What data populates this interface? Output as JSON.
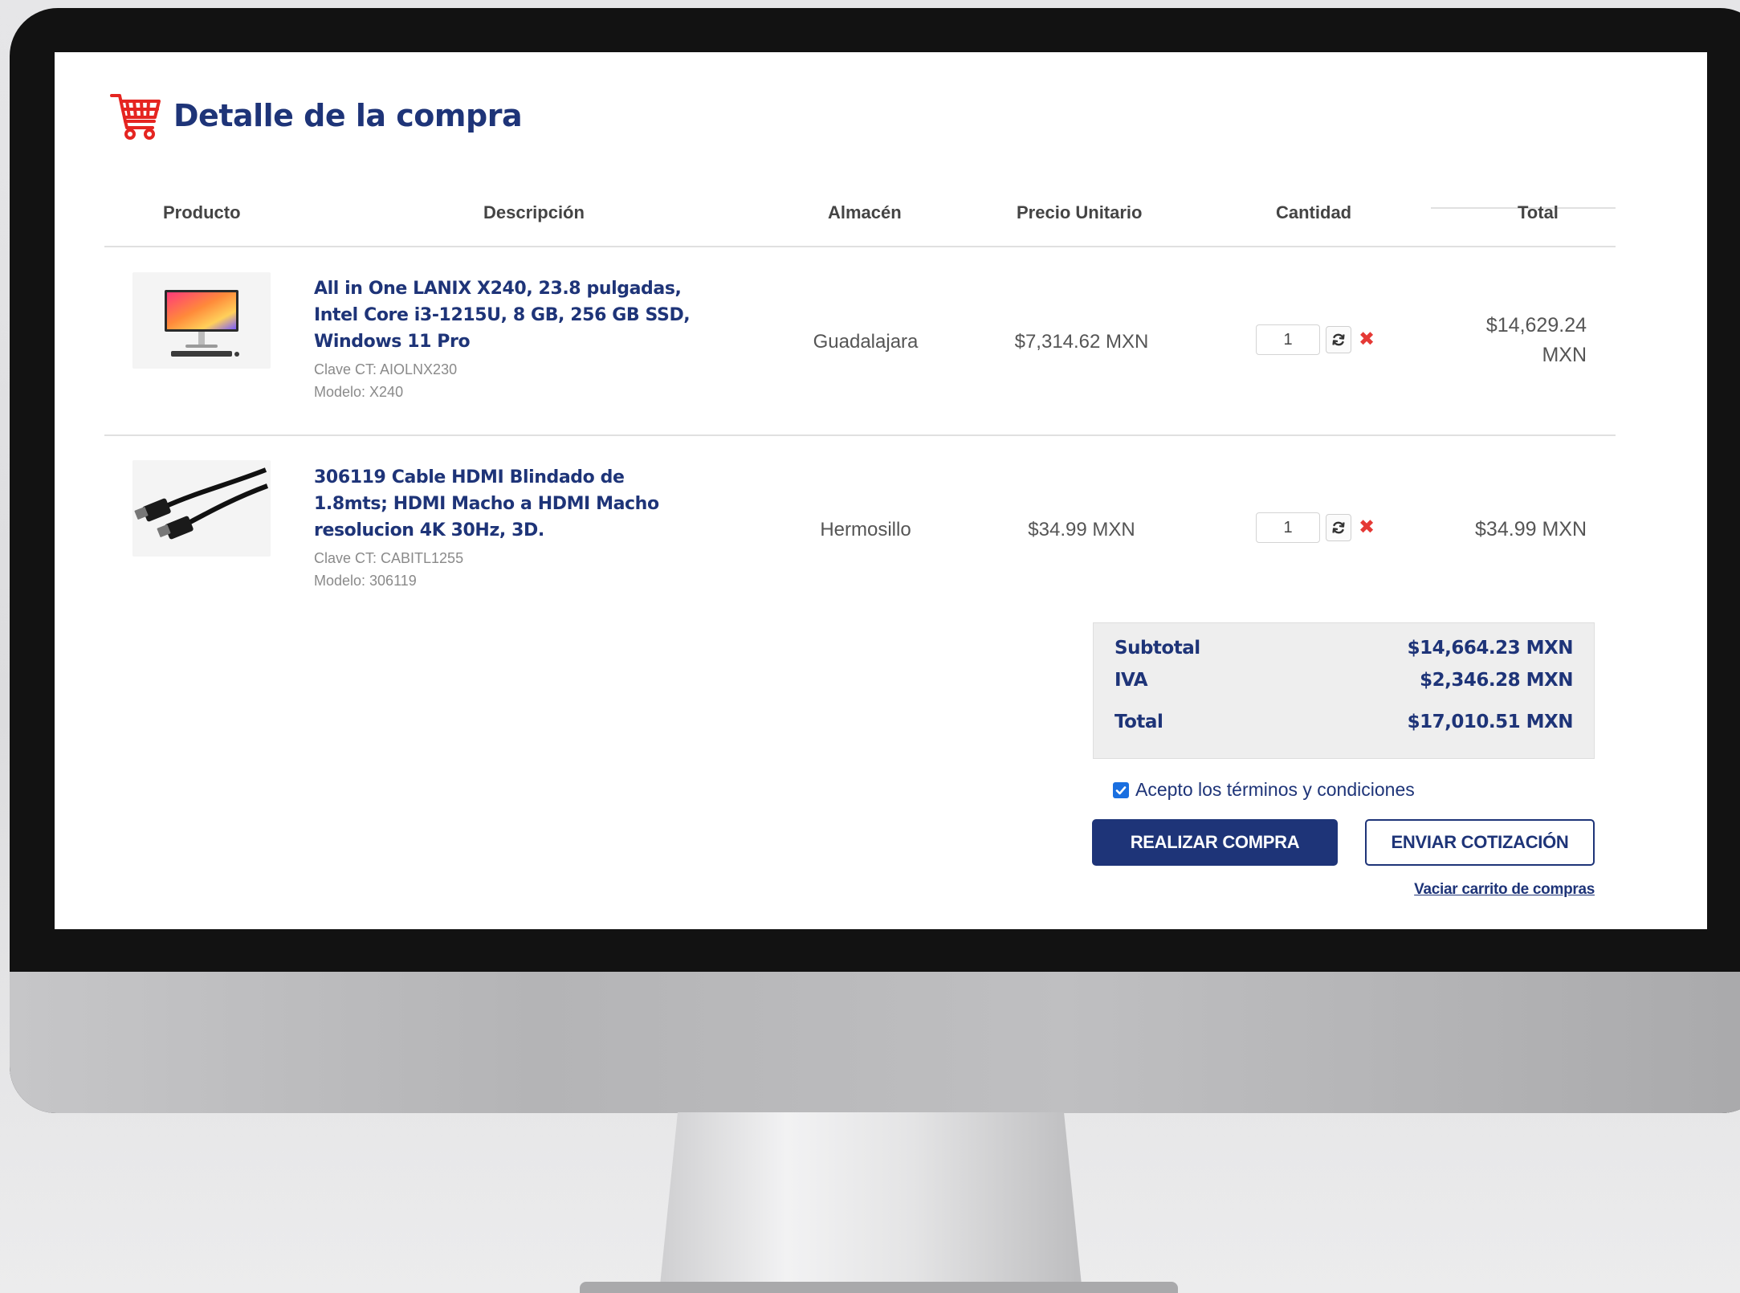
{
  "page": {
    "title": "Detalle de la compra"
  },
  "table": {
    "headers": {
      "product": "Producto",
      "description": "Descripción",
      "warehouse": "Almacén",
      "unit_price": "Precio Unitario",
      "quantity": "Cantidad",
      "total": "Total"
    },
    "rows": [
      {
        "image_icon": "all-in-one-computer-image",
        "title": "All in One LANIX X240, 23.8 pulgadas, Intel Core i3-1215U, 8 GB, 256 GB SSD, Windows 11 Pro",
        "clave": "Clave CT: AIOLNX230",
        "modelo": "Modelo: X240",
        "warehouse": "Guadalajara",
        "unit_price": "$7,314.62 MXN",
        "quantity": "1",
        "total_amount": "$14,629.24",
        "total_currency": "MXN"
      },
      {
        "image_icon": "hdmi-cable-image",
        "title": "306119 Cable HDMI Blindado de 1.8mts; HDMI Macho a HDMI Macho resolucion 4K 30Hz, 3D.",
        "clave": "Clave CT: CABITL1255",
        "modelo": "Modelo: 306119",
        "warehouse": "Hermosillo",
        "unit_price": "$34.99 MXN",
        "quantity": "1",
        "total_amount": "$34.99 MXN",
        "total_currency": ""
      }
    ]
  },
  "summary": {
    "subtotal_label": "Subtotal",
    "subtotal_value": "$14,664.23 MXN",
    "iva_label": "IVA",
    "iva_value": "$2,346.28 MXN",
    "total_label": "Total",
    "total_value": "$17,010.51 MXN"
  },
  "terms": {
    "label": "Acepto los términos y condiciones",
    "checked": true
  },
  "actions": {
    "purchase": "REALIZAR COMPRA",
    "quote": "ENVIAR COTIZACIÓN",
    "empty_cart": "Vaciar carrito de compras"
  },
  "icons": {
    "cart": "shopping-cart-icon",
    "refresh": "refresh-icon",
    "remove": "remove-icon",
    "remove_glyph": "✖",
    "check": "checkmark-icon"
  },
  "colors": {
    "brand_navy": "#1e3478",
    "remove_red": "#e53935",
    "cart_red": "#e52521",
    "checkbox_blue": "#1a6fe0"
  }
}
